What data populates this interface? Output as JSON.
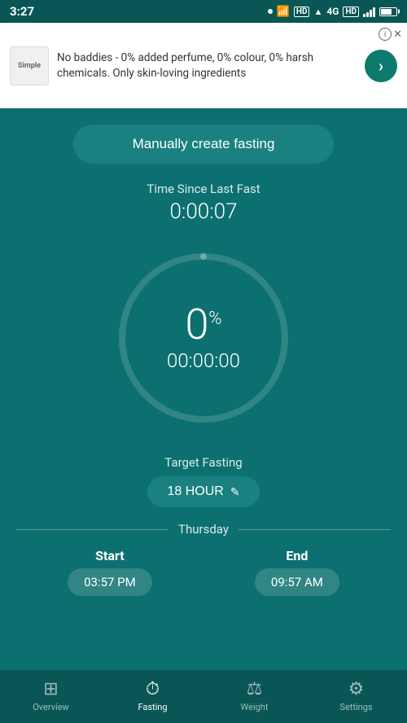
{
  "statusBar": {
    "time": "3:27",
    "hdBadge1": "HD",
    "network": "4G",
    "hdBadge2": "HD"
  },
  "ad": {
    "logoText": "Simple",
    "text": "No baddies - 0% added perfume, 0% colour, 0% harsh chemicals. Only skin-loving ingredients",
    "arrowLabel": "›",
    "closeLabel": "✕",
    "infoLabel": "i"
  },
  "main": {
    "createFastingLabel": "Manually create fasting",
    "timeSinceLabel": "Time Since Last Fast",
    "timeSinceValue": "0:00:07",
    "percentValue": "0",
    "percentSign": "%",
    "timerValue": "00:00:00",
    "targetLabel": "Target Fasting",
    "targetValue": "18 HOUR",
    "editIcon": "✎",
    "dayLabel": "Thursday",
    "startLabel": "Start",
    "startValue": "03:57 PM",
    "endLabel": "End",
    "endValue": "09:57 AM"
  },
  "bottomNav": {
    "items": [
      {
        "id": "overview",
        "label": "Overview",
        "icon": "⊞"
      },
      {
        "id": "fasting",
        "label": "Fasting",
        "icon": "⏱"
      },
      {
        "id": "weight",
        "label": "Weight",
        "icon": "⚖"
      },
      {
        "id": "settings",
        "label": "Settings",
        "icon": "⚙"
      }
    ],
    "activeIndex": 1
  }
}
